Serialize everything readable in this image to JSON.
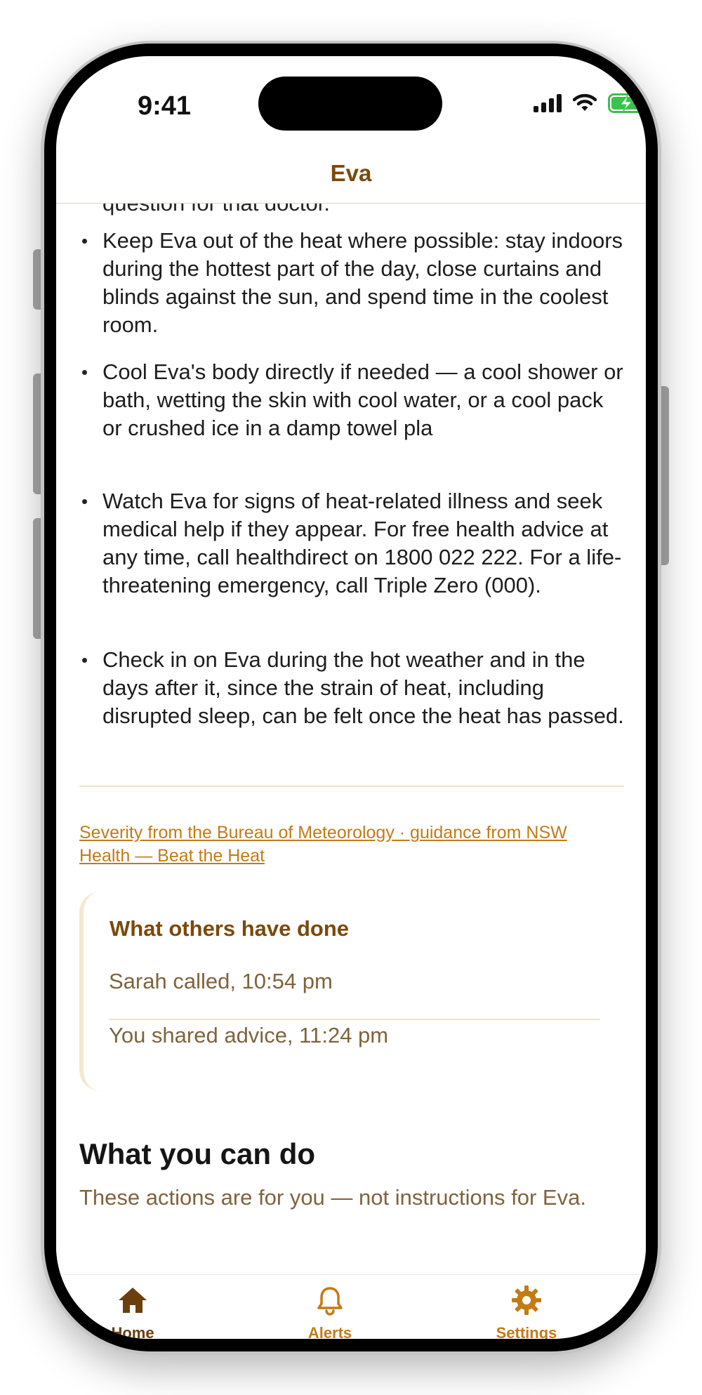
{
  "status_bar": {
    "time": "9:41"
  },
  "header": {
    "title": "Eva"
  },
  "content": {
    "cut_off_text": "question for that doctor.",
    "bullets": [
      {
        "text": "Keep Eva out of the heat where possible: stay indoors during the hottest part of the day, close curtains and blinds against the sun, and spend time in the coolest room."
      },
      {
        "text": "Cool Eva's body directly if needed — a cool shower or bath, wetting the skin with cool water, or a cool pack or crushed ice in a damp towel pla"
      },
      {
        "text": "Watch Eva for signs of heat-related illness and seek medical help if they appear. For free health advice at any time, call healthdirect on 1800 022 222. For a life-threatening emergency, call Triple Zero (000)."
      },
      {
        "text": "Check in on Eva during the hot weather and in the days after it, since the strain of heat, including disrupted sleep, can be felt once the heat has passed."
      }
    ],
    "source_link": "Severity from the Bureau of Meteorology · guidance from NSW Health — Beat the Heat",
    "others_card": {
      "title": "What others have done",
      "items": [
        "Sarah called, 10:54 pm",
        "You shared advice, 11:24 pm"
      ]
    },
    "section": {
      "title": "What you can do",
      "subtitle": "These actions are for you — not instructions for Eva."
    }
  },
  "tab_bar": {
    "items": [
      {
        "label": "Home",
        "icon": "house-icon",
        "active": true
      },
      {
        "label": "Alerts",
        "icon": "bell-icon",
        "active": false
      },
      {
        "label": "Settings",
        "icon": "gear-icon",
        "active": false
      }
    ]
  },
  "colors": {
    "brand_dark": "#7a4a0c",
    "accent": "#c37b14",
    "muted_text": "#80633c",
    "battery_green": "#3cc04e"
  }
}
